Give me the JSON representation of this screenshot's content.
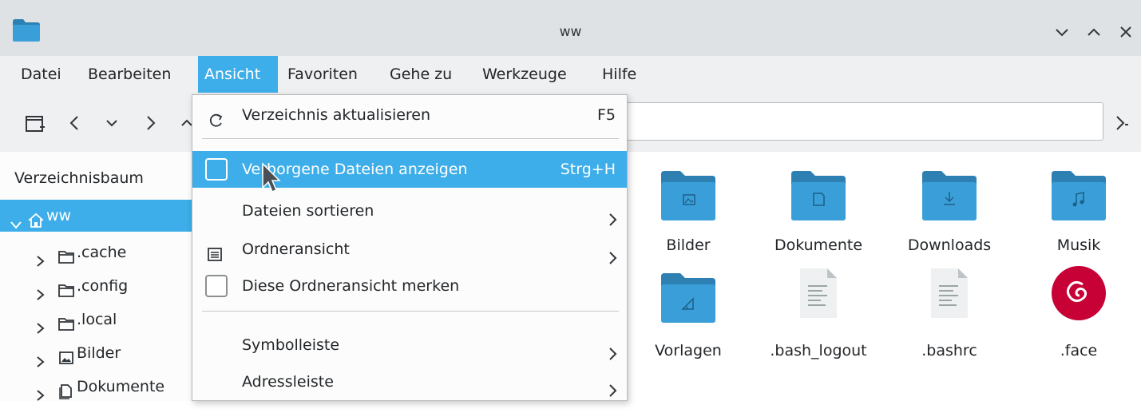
{
  "window": {
    "title": "ww"
  },
  "menubar": {
    "items": [
      {
        "label": "Datei"
      },
      {
        "label": "Bearbeiten"
      },
      {
        "label": "Ansicht",
        "active": true
      },
      {
        "label": "Favoriten"
      },
      {
        "label": "Gehe zu"
      },
      {
        "label": "Werkzeuge"
      },
      {
        "label": "Hilfe"
      }
    ]
  },
  "toolbar": {
    "icons": [
      "new-tab-icon",
      "back-icon",
      "history-icon",
      "forward-icon",
      "up-icon"
    ],
    "address": {
      "value": ""
    },
    "go_icon": "go-icon"
  },
  "sidebar": {
    "title": "Verzeichnisbaum",
    "tree": [
      {
        "label": "ww",
        "icon": "home-icon",
        "expanded": true,
        "selected": true
      },
      {
        "label": ".cache",
        "icon": "folder-icon"
      },
      {
        "label": ".config",
        "icon": "folder-icon"
      },
      {
        "label": ".local",
        "icon": "folder-icon"
      },
      {
        "label": "Bilder",
        "icon": "pictures-icon"
      },
      {
        "label": "Dokumente",
        "icon": "documents-icon"
      }
    ]
  },
  "files": [
    {
      "name": "Bilder",
      "icon": "folder-pictures-icon"
    },
    {
      "name": "Dokumente",
      "icon": "folder-documents-icon"
    },
    {
      "name": "Downloads",
      "icon": "folder-downloads-icon"
    },
    {
      "name": "Musik",
      "icon": "folder-music-icon"
    },
    {
      "name": "Vorlagen",
      "icon": "folder-templates-icon"
    },
    {
      "name": ".bash_logout",
      "icon": "text-file-icon"
    },
    {
      "name": ".bashrc",
      "icon": "text-file-icon"
    },
    {
      "name": ".face",
      "icon": "debian-logo-icon"
    }
  ],
  "view_menu": {
    "items": [
      {
        "label": "Verzeichnis aktualisieren",
        "shortcut": "F5",
        "icon": "refresh-icon"
      },
      {
        "label": "Verborgene Dateien anzeigen",
        "shortcut": "Strg+H",
        "checkbox": true,
        "checked": false,
        "highlighted": true
      },
      {
        "label": "Dateien sortieren",
        "submenu": true
      },
      {
        "label": "Ordneransicht",
        "submenu": true,
        "icon": "view-list-icon"
      },
      {
        "label": "Diese Ordneransicht merken",
        "checkbox": true,
        "checked": false
      },
      {
        "label": "Symbolleiste",
        "submenu": true
      },
      {
        "label": "Adressleiste",
        "submenu": true
      }
    ]
  },
  "colors": {
    "accent": "#3daee9",
    "folder": "#3a9fd9",
    "folder_tab": "#2e80b3",
    "debian": "#c70036"
  }
}
